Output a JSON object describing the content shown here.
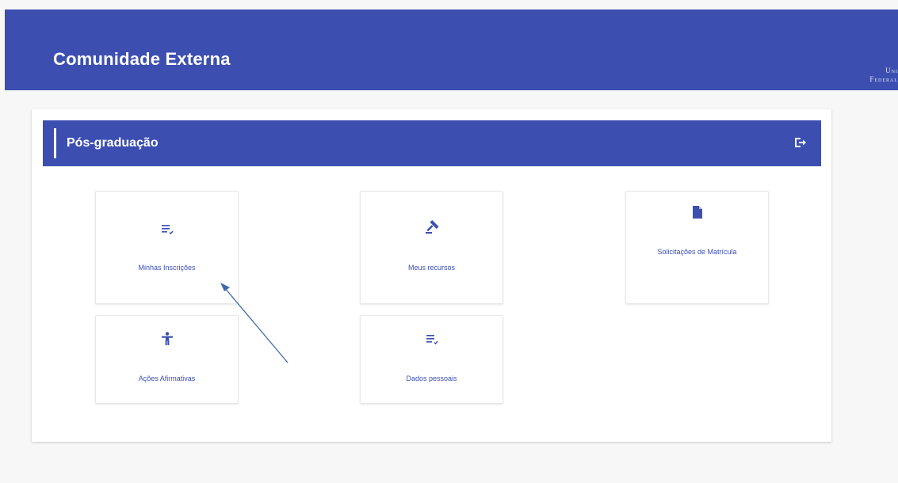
{
  "header": {
    "title": "Comunidade Externa",
    "brand_line1": "Uni",
    "brand_line2": "Federal"
  },
  "section": {
    "title": "Pós-graduação",
    "exit_icon": "logout-icon"
  },
  "cards": [
    {
      "label": "Minhas Inscrições",
      "icon": "list-icon"
    },
    {
      "label": "Meus recursos",
      "icon": "gavel-icon"
    },
    {
      "label": "Solicitações de Matrícula",
      "icon": "document-icon"
    },
    {
      "label": "Ações Afirmativas",
      "icon": "accessibility-icon"
    },
    {
      "label": "Dados pessoais",
      "icon": "list-icon"
    }
  ],
  "colors": {
    "primary": "#3c4fb1",
    "background": "#f7f7f7",
    "arrow": "#3f6aa8"
  }
}
